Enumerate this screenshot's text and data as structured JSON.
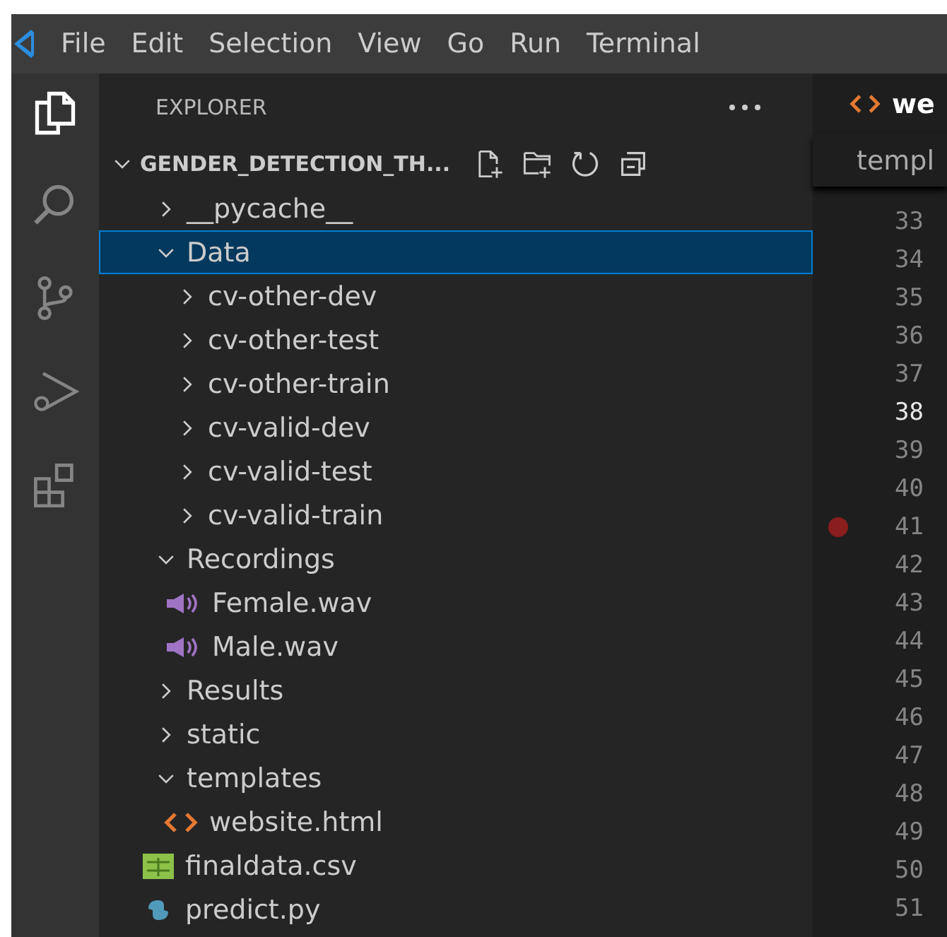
{
  "menu": {
    "items": [
      "File",
      "Edit",
      "Selection",
      "View",
      "Go",
      "Run",
      "Terminal"
    ]
  },
  "activity_bar": {
    "items": [
      {
        "kind": "explorer",
        "selected": true
      },
      {
        "kind": "search",
        "selected": false
      },
      {
        "kind": "source-control",
        "selected": false
      },
      {
        "kind": "run-debug",
        "selected": false
      },
      {
        "kind": "extensions",
        "selected": false
      }
    ]
  },
  "sidebar": {
    "title": "EXPLORER",
    "root": {
      "label": "GENDER_DETECTION_TH...",
      "expanded": true,
      "children": [
        {
          "label": "__pycache__",
          "kind": "folder",
          "expanded": false,
          "selected": false
        },
        {
          "label": "Data",
          "kind": "folder",
          "expanded": true,
          "selected": true,
          "children": [
            {
              "label": "cv-other-dev",
              "kind": "folder",
              "expanded": false,
              "selected": false
            },
            {
              "label": "cv-other-test",
              "kind": "folder",
              "expanded": false,
              "selected": false
            },
            {
              "label": "cv-other-train",
              "kind": "folder",
              "expanded": false,
              "selected": false
            },
            {
              "label": "cv-valid-dev",
              "kind": "folder",
              "expanded": false,
              "selected": false
            },
            {
              "label": "cv-valid-test",
              "kind": "folder",
              "expanded": false,
              "selected": false
            },
            {
              "label": "cv-valid-train",
              "kind": "folder",
              "expanded": false,
              "selected": false
            }
          ]
        },
        {
          "label": "Recordings",
          "kind": "folder",
          "expanded": true,
          "selected": false,
          "children": [
            {
              "label": "Female.wav",
              "kind": "audio",
              "selected": false
            },
            {
              "label": "Male.wav",
              "kind": "audio",
              "selected": false
            }
          ]
        },
        {
          "label": "Results",
          "kind": "folder",
          "expanded": false,
          "selected": false
        },
        {
          "label": "static",
          "kind": "folder",
          "expanded": false,
          "selected": false
        },
        {
          "label": "templates",
          "kind": "folder",
          "expanded": true,
          "selected": false,
          "children": [
            {
              "label": "website.html",
              "kind": "html",
              "selected": false
            }
          ]
        },
        {
          "label": "finaldata.csv",
          "kind": "csv",
          "selected": false
        },
        {
          "label": "predict.py",
          "kind": "python",
          "selected": false
        }
      ]
    }
  },
  "editor": {
    "tab": {
      "label": "we",
      "kind": "html"
    },
    "breadcrumb": "templ",
    "lines": [
      {
        "number": "33",
        "current": false,
        "breakpoint": false
      },
      {
        "number": "34",
        "current": false,
        "breakpoint": false
      },
      {
        "number": "35",
        "current": false,
        "breakpoint": false
      },
      {
        "number": "36",
        "current": false,
        "breakpoint": false
      },
      {
        "number": "37",
        "current": false,
        "breakpoint": false
      },
      {
        "number": "38",
        "current": true,
        "breakpoint": false
      },
      {
        "number": "39",
        "current": false,
        "breakpoint": false
      },
      {
        "number": "40",
        "current": false,
        "breakpoint": false
      },
      {
        "number": "41",
        "current": false,
        "breakpoint": true
      },
      {
        "number": "42",
        "current": false,
        "breakpoint": false
      },
      {
        "number": "43",
        "current": false,
        "breakpoint": false
      },
      {
        "number": "44",
        "current": false,
        "breakpoint": false
      },
      {
        "number": "45",
        "current": false,
        "breakpoint": false
      },
      {
        "number": "46",
        "current": false,
        "breakpoint": false
      },
      {
        "number": "47",
        "current": false,
        "breakpoint": false
      },
      {
        "number": "48",
        "current": false,
        "breakpoint": false
      },
      {
        "number": "49",
        "current": false,
        "breakpoint": false
      },
      {
        "number": "50",
        "current": false,
        "breakpoint": false
      },
      {
        "number": "51",
        "current": false,
        "breakpoint": false
      }
    ]
  }
}
